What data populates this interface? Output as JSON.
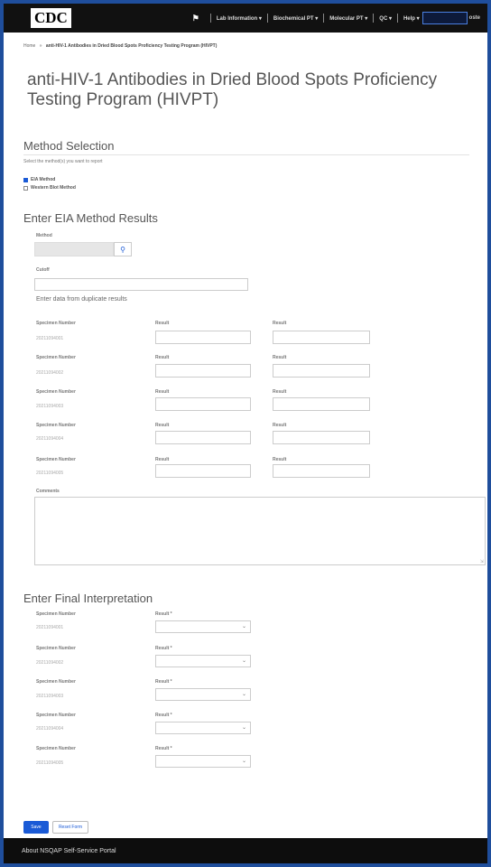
{
  "header": {
    "logo": "CDC",
    "nav": [
      "Lab Information ▾",
      "Biochemical PT ▾",
      "Molecular PT ▾",
      "QC ▾",
      "Help ▾"
    ],
    "user_fragment": "oste"
  },
  "breadcrumb": {
    "home": "Home",
    "separator": "»",
    "current": "anti-HIV-1 Antibodies in Dried Blood Spots Proficiency Testing Program (HIVPT)"
  },
  "page_title": "anti-HIV-1 Antibodies in Dried Blood Spots Proficiency Testing Program (HIVPT)",
  "method_selection": {
    "title": "Method Selection",
    "instruction": "Select the method(s) you want to report",
    "options": [
      {
        "label": "EIA Method",
        "checked": true
      },
      {
        "label": "Western Blot Method",
        "checked": false
      }
    ]
  },
  "eia": {
    "title": "Enter EIA Method Results",
    "method_label": "Method",
    "method_value": "",
    "cutoff_label": "Cutoff",
    "cutoff_value": "",
    "duplicate_note": "Enter data from duplicate results",
    "specimen_label": "Specimen Number",
    "result_label": "Result",
    "rows": [
      "20211094001",
      "20211094002",
      "20211094003",
      "20211094004",
      "20211094005"
    ],
    "comments_label": "Comments"
  },
  "final": {
    "title": "Enter Final Interpretation",
    "specimen_label": "Specimen Number",
    "result_label": "Result *",
    "rows": [
      "20211094001",
      "20211094002",
      "20211094003",
      "20211094004",
      "20211094005"
    ]
  },
  "actions": {
    "save": "Save",
    "reset": "Reset Form"
  },
  "footer": {
    "text": "About NSQAP Self-Service Portal"
  },
  "colors": {
    "primary": "#1a5ad6",
    "topbar": "#111111",
    "page_border": "#1f4e9c"
  }
}
